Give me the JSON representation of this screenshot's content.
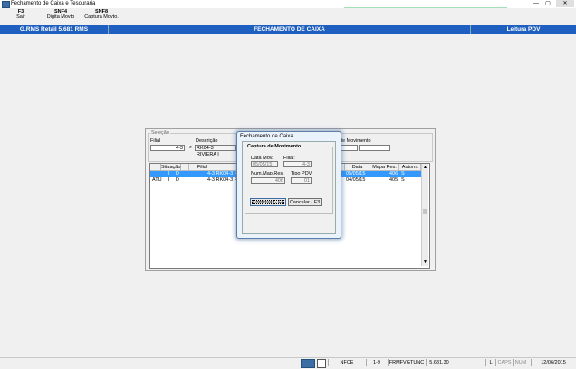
{
  "window": {
    "title": "Fechamento de Caixa e Tesouraria",
    "close": "✕",
    "maximize": "▢",
    "minimize": "—"
  },
  "toolbar": [
    {
      "key": "F3",
      "label": "Sair"
    },
    {
      "key": "SNF4",
      "label": "Digita Movto"
    },
    {
      "key": "SNF8",
      "label": "Captura Movto."
    }
  ],
  "header": {
    "left": "G.RMS Retail 5.681 RMS",
    "center": "FECHAMENTO DE CAIXA",
    "right": "Leitura PDV"
  },
  "selecao": {
    "group_label": "Seleção",
    "filial_label": "Filial",
    "filial_value": "4-3",
    "descricao_label": "Descrição",
    "descricao_value": "RK04-3 RIVIERA I",
    "movimento_label": "de Movimento"
  },
  "list": {
    "columns": [
      "Situação",
      "Filial",
      "Data",
      "Mapa Res.",
      "Autom."
    ],
    "rows": [
      {
        "situacao": "",
        "c1": "I",
        "c2": "D",
        "filial": "4-3 RK04-3 R",
        "data": "05/05/15",
        "mapa": "406",
        "autom": "S",
        "selected": true
      },
      {
        "situacao": "ATU",
        "c1": "I",
        "c2": "D",
        "filial": "4-3 RK04-3 R",
        "data": "04/05/15",
        "mapa": "405",
        "autom": "S",
        "selected": false
      }
    ]
  },
  "dialog": {
    "title": "Fechamento de Caixa",
    "group_label": "Captura de Movimento",
    "data_mov_label": "Data Mov.",
    "data_mov_value": "05/05/15",
    "filial_label": "Filial:",
    "filial_value": "4-3",
    "num_map_label": "Num.Map.Res.",
    "num_map_value": "406",
    "tipo_pdv_label": "Tipo PDV",
    "tipo_pdv_value": "01",
    "continue_label": "Continuar - F4",
    "cancel_label": "Cancelar - F3"
  },
  "status": {
    "nfce": "NFCE",
    "loja": "1-9",
    "program": "FRMFVGTUNC",
    "version": "5.681.30",
    "l": "L",
    "caps": "CAPS",
    "num": "NUM",
    "date": "12/06/2015"
  }
}
